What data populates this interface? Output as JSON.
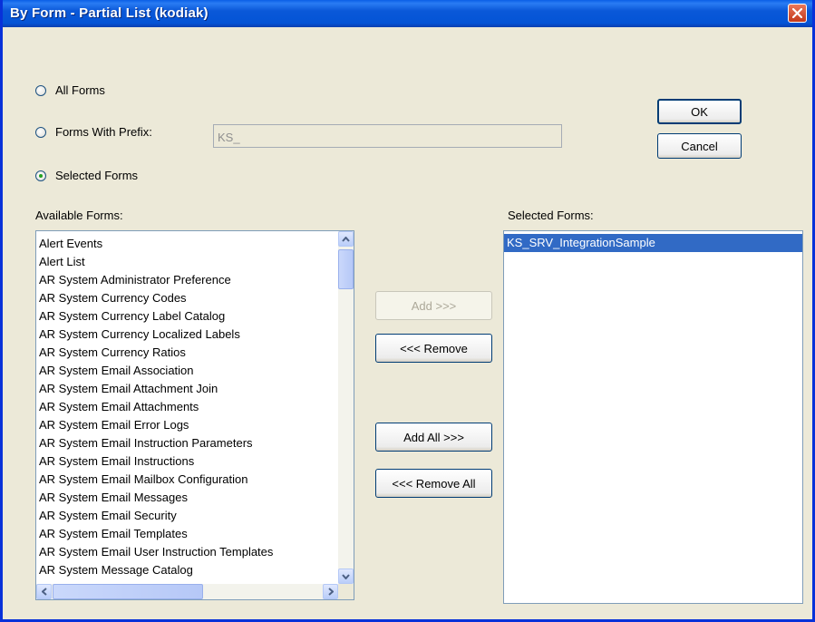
{
  "window": {
    "title": "By Form - Partial List (kodiak)"
  },
  "options": {
    "all_forms": "All Forms",
    "prefix_label": "Forms With Prefix:",
    "prefix_value": "KS_",
    "selected_forms": "Selected Forms",
    "selected_option": "Selected Forms"
  },
  "buttons": {
    "ok": "OK",
    "cancel": "Cancel",
    "add": "Add >>>",
    "remove": "<<< Remove",
    "add_all": "Add All >>>",
    "remove_all": "<<< Remove All"
  },
  "available": {
    "label": "Available Forms:",
    "items": [
      "Alert Events",
      "Alert List",
      "AR System Administrator Preference",
      "AR System Currency Codes",
      "AR System Currency Label Catalog",
      "AR System Currency Localized Labels",
      "AR System Currency Ratios",
      "AR System Email Association",
      "AR System Email Attachment Join",
      "AR System Email Attachments",
      "AR System Email Error Logs",
      "AR System Email Instruction Parameters",
      "AR System Email Instructions",
      "AR System Email Mailbox Configuration",
      "AR System Email Messages",
      "AR System Email Security",
      "AR System Email Templates",
      "AR System Email User Instruction Templates",
      "AR System Message Catalog"
    ]
  },
  "selected": {
    "label": "Selected Forms:",
    "items": [
      "KS_SRV_IntegrationSample"
    ]
  }
}
